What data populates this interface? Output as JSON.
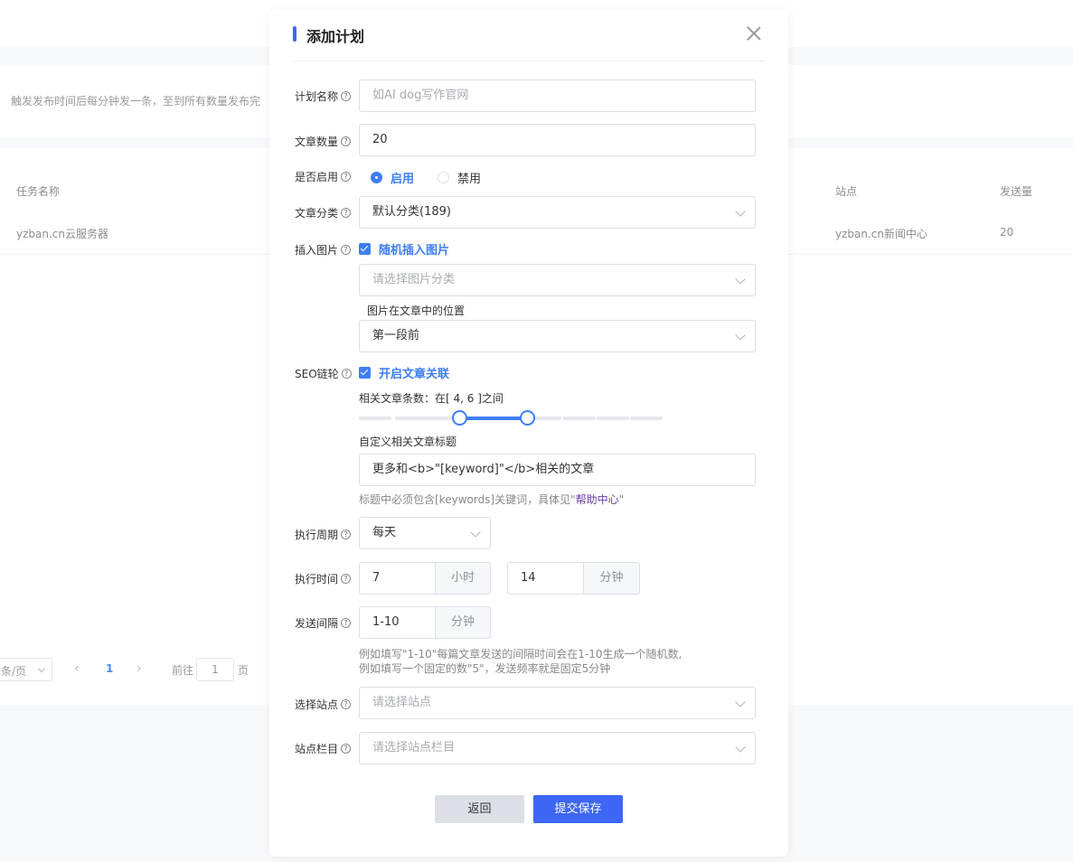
{
  "background": {
    "notice_text": "触发发布时间后每分钟发一条，至到所有数量发布完",
    "table": {
      "headers": {
        "task_name": "任务名称",
        "site": "站点",
        "send_count": "发送量"
      },
      "row": {
        "task_name": "yzban.cn云服务器",
        "site": "yzban.cn新闻中心",
        "send_count": "20"
      }
    },
    "pager": {
      "page_size_label": "条/页",
      "prev_icon": "‹",
      "next_icon": "›",
      "current_page": "1",
      "goto_label": "前往",
      "goto_value": "1",
      "page_unit": "页"
    }
  },
  "modal": {
    "title": "添加计划",
    "accent_color": "#3d66f5",
    "close_icon": "close-icon",
    "help_icon": "?",
    "plan_name": {
      "label": "计划名称",
      "placeholder": "如AI dog写作官网",
      "value": ""
    },
    "article_count": {
      "label": "文章数量",
      "value": "20"
    },
    "enabled": {
      "label": "是否启用",
      "options": [
        "启用",
        "禁用"
      ],
      "selected": "启用"
    },
    "category": {
      "label": "文章分类",
      "value": "默认分类(189)"
    },
    "insert_image": {
      "label": "插入图片",
      "checkbox_label": "随机插入图片",
      "checked": true,
      "image_category_placeholder": "请选择图片分类",
      "position_label": "图片在文章中的位置",
      "position_value": "第一段前"
    },
    "seo_link": {
      "label": "SEO链轮",
      "checkbox_label": "开启文章关联",
      "checked": true,
      "related_count_label": "相关文章条数：在[ 4, 6 ]之间",
      "range_min": 4,
      "range_max": 6,
      "custom_title_label": "自定义相关文章标题",
      "custom_title_value": "更多和<b>\"[keyword]\"</b>相关的文章",
      "hint_prefix": "标题中必须包含[keywords]关键词，具体见\"",
      "hint_link": "帮助中心",
      "hint_suffix": "\""
    },
    "cycle": {
      "label": "执行周期",
      "value": "每天"
    },
    "exec_time": {
      "label": "执行时间",
      "hour_value": "7",
      "hour_unit": "小时",
      "minute_value": "14",
      "minute_unit": "分钟"
    },
    "interval": {
      "label": "发送间隔",
      "value": "1-10",
      "unit": "分钟",
      "hint_line1": "例如填写\"1-10\"每篇文章发送的间隔时间会在1-10生成一个随机数,",
      "hint_line2": "例如填写一个固定的数\"5\"，发送频率就是固定5分钟"
    },
    "site": {
      "label": "选择站点",
      "placeholder": "请选择站点"
    },
    "column": {
      "label": "站点栏目",
      "placeholder": "请选择站点栏目"
    },
    "buttons": {
      "back": "返回",
      "save": "提交保存"
    }
  }
}
